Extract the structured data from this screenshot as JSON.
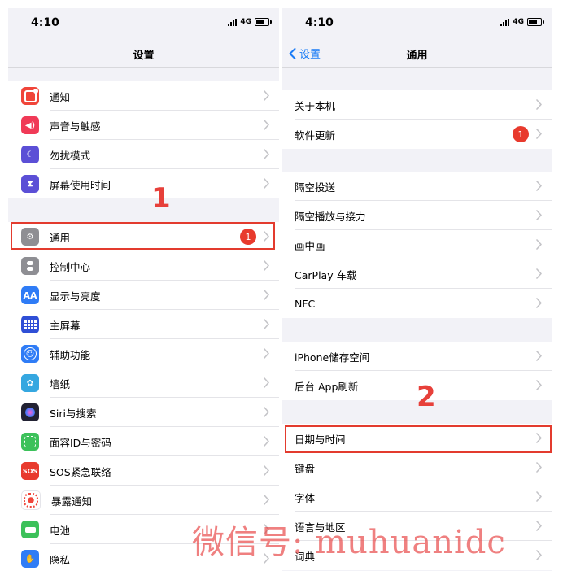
{
  "status_bar": {
    "time": "4:10",
    "network": "4G"
  },
  "left_screen": {
    "title": "设置",
    "groups": [
      [
        {
          "label": "通知",
          "icon": "notifications-icon",
          "color": "#f0453a"
        },
        {
          "label": "声音与触感",
          "icon": "sound-icon",
          "color": "#f03a57"
        },
        {
          "label": "勿扰模式",
          "icon": "moon-icon",
          "color": "#5b4fd6"
        },
        {
          "label": "屏幕使用时间",
          "icon": "hourglass-icon",
          "color": "#5b4fd6"
        }
      ],
      [
        {
          "label": "通用",
          "icon": "gear-icon",
          "color": "#8e8e93",
          "badge": "1"
        },
        {
          "label": "控制中心",
          "icon": "toggles-icon",
          "color": "#8e8e93"
        },
        {
          "label": "显示与亮度",
          "icon": "aa-icon",
          "color": "#2f7cf6",
          "icon_text": "AA"
        },
        {
          "label": "主屏幕",
          "icon": "home-grid-icon",
          "color": "#2f4fd6"
        },
        {
          "label": "辅助功能",
          "icon": "accessibility-icon",
          "color": "#2f7cf6"
        },
        {
          "label": "墙纸",
          "icon": "flower-icon",
          "color": "#35a7e0"
        },
        {
          "label": "Siri与搜索",
          "icon": "siri-icon",
          "color": "#222233"
        },
        {
          "label": "面容ID与密码",
          "icon": "faceid-icon",
          "color": "#3cc15a"
        },
        {
          "label": "SOS紧急联络",
          "icon": "sos-icon",
          "color": "#e83a2d",
          "icon_text": "SOS"
        },
        {
          "label": "暴露通知",
          "icon": "exposure-icon",
          "color": "#ffffff"
        },
        {
          "label": "电池",
          "icon": "battery-icon",
          "color": "#3cc15a"
        },
        {
          "label": "隐私",
          "icon": "hand-icon",
          "color": "#2f7cf6"
        }
      ]
    ]
  },
  "right_screen": {
    "back_label": "设置",
    "title": "通用",
    "groups": [
      [
        {
          "label": "关于本机"
        },
        {
          "label": "软件更新",
          "badge": "1"
        }
      ],
      [
        {
          "label": "隔空投送"
        },
        {
          "label": "隔空播放与接力"
        },
        {
          "label": "画中画"
        },
        {
          "label": "CarPlay 车载"
        },
        {
          "label": "NFC"
        }
      ],
      [
        {
          "label": "iPhone储存空间"
        },
        {
          "label": "后台 App刷新"
        }
      ],
      [
        {
          "label": "日期与时间"
        },
        {
          "label": "键盘"
        },
        {
          "label": "字体"
        },
        {
          "label": "语言与地区"
        },
        {
          "label": "词典"
        }
      ]
    ]
  },
  "annotations": {
    "step1": "1",
    "step2": "2",
    "highlight_color": "#e33b2e"
  },
  "watermark": "微信号: muhuanidc"
}
